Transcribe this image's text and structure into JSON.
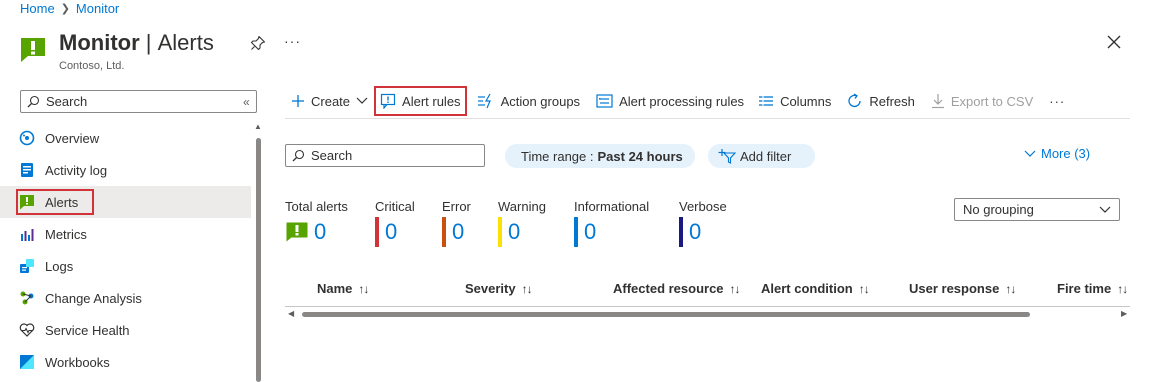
{
  "breadcrumb": {
    "home": "Home",
    "current": "Monitor"
  },
  "header": {
    "title_main": "Monitor",
    "title_separator": " | ",
    "title_sub": "Alerts",
    "subtitle": "Contoso, Ltd.",
    "more": "···"
  },
  "sidebar": {
    "search_placeholder": "Search",
    "collapse": "«",
    "items": [
      {
        "label": "Overview",
        "icon": "overview-icon"
      },
      {
        "label": "Activity log",
        "icon": "activity-log-icon"
      },
      {
        "label": "Alerts",
        "icon": "alerts-icon",
        "active": true
      },
      {
        "label": "Metrics",
        "icon": "metrics-icon"
      },
      {
        "label": "Logs",
        "icon": "logs-icon"
      },
      {
        "label": "Change Analysis",
        "icon": "change-analysis-icon"
      },
      {
        "label": "Service Health",
        "icon": "service-health-icon"
      },
      {
        "label": "Workbooks",
        "icon": "workbooks-icon"
      }
    ]
  },
  "toolbar": {
    "create": "Create",
    "alert_rules": "Alert rules",
    "action_groups": "Action groups",
    "alert_processing_rules": "Alert processing rules",
    "columns": "Columns",
    "refresh": "Refresh",
    "export_csv": "Export to CSV",
    "more": "···"
  },
  "filters": {
    "search_placeholder": "Search",
    "time_range_label": "Time range : ",
    "time_range_value": "Past 24 hours",
    "add_filter": "Add filter",
    "more": "More (3)"
  },
  "summary": {
    "total": {
      "label": "Total alerts",
      "value": "0"
    },
    "critical": {
      "label": "Critical",
      "value": "0"
    },
    "error": {
      "label": "Error",
      "value": "0"
    },
    "warning": {
      "label": "Warning",
      "value": "0"
    },
    "informational": {
      "label": "Informational",
      "value": "0"
    },
    "verbose": {
      "label": "Verbose",
      "value": "0"
    }
  },
  "grouping": {
    "selected": "No grouping"
  },
  "table": {
    "columns": [
      "Name",
      "Severity",
      "Affected resource",
      "Alert condition",
      "User response",
      "Fire time"
    ]
  },
  "colors": {
    "accent": "#0078d4",
    "critical": "#d13438",
    "error": "#ca5010",
    "warning": "#fce100",
    "informational": "#0078d4",
    "verbose": "#1b1a84",
    "alert_green": "#57a300",
    "highlight_red": "#d13438"
  }
}
